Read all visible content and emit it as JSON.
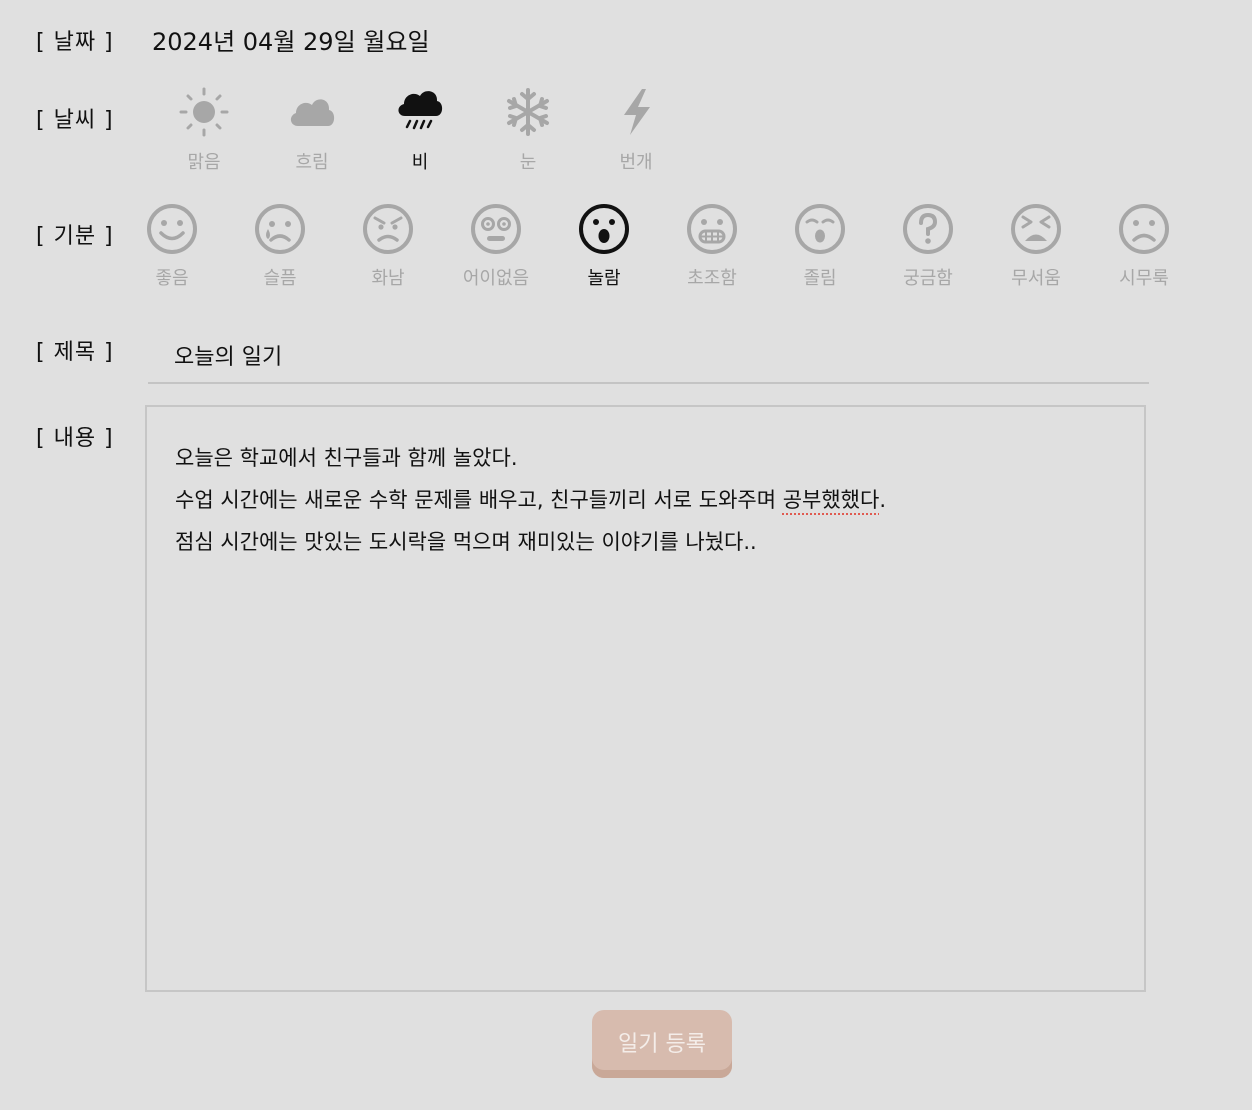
{
  "labels": {
    "date": "[ 날짜 ]",
    "weather": "[ 날씨 ]",
    "mood": "[ 기분 ]",
    "title": "[ 제목 ]",
    "content": "[ 내용 ]"
  },
  "date": "2024년 04월 29일 월요일",
  "weather": {
    "selected": "비",
    "options": [
      {
        "label": "맑음",
        "icon": "sun-icon"
      },
      {
        "label": "흐림",
        "icon": "cloud-icon"
      },
      {
        "label": "비",
        "icon": "rain-icon"
      },
      {
        "label": "눈",
        "icon": "snow-icon"
      },
      {
        "label": "번개",
        "icon": "lightning-icon"
      }
    ]
  },
  "mood": {
    "selected": "놀람",
    "options": [
      {
        "label": "좋음",
        "icon": "smile-face-icon"
      },
      {
        "label": "슬픔",
        "icon": "sad-face-icon"
      },
      {
        "label": "화남",
        "icon": "angry-face-icon"
      },
      {
        "label": "어이없음",
        "icon": "dumbfounded-face-icon"
      },
      {
        "label": "놀람",
        "icon": "surprised-face-icon"
      },
      {
        "label": "초조함",
        "icon": "nervous-face-icon"
      },
      {
        "label": "졸림",
        "icon": "sleepy-face-icon"
      },
      {
        "label": "궁금함",
        "icon": "question-face-icon"
      },
      {
        "label": "무서움",
        "icon": "scared-face-icon"
      },
      {
        "label": "시무룩",
        "icon": "sulky-face-icon"
      }
    ]
  },
  "title_value": "오늘의 일기",
  "content": {
    "line1": "오늘은 학교에서 친구들과 함께 놀았다.",
    "line2_before": "수업 시간에는 새로운 수학 문제를 배우고, 친구들끼리 서로 도와주며 ",
    "line2_flagged": "공부했했다",
    "line2_after": ".",
    "line3": "점심 시간에는 맛있는 도시락을 먹으며 재미있는 이야기를 나눴다.."
  },
  "submit_label": "일기 등록",
  "colors": {
    "background": "#e0e0e0",
    "inactive": "#a7a7a7",
    "active": "#111111",
    "button": "#d7bbae",
    "spellcheck": "#e05a50"
  }
}
